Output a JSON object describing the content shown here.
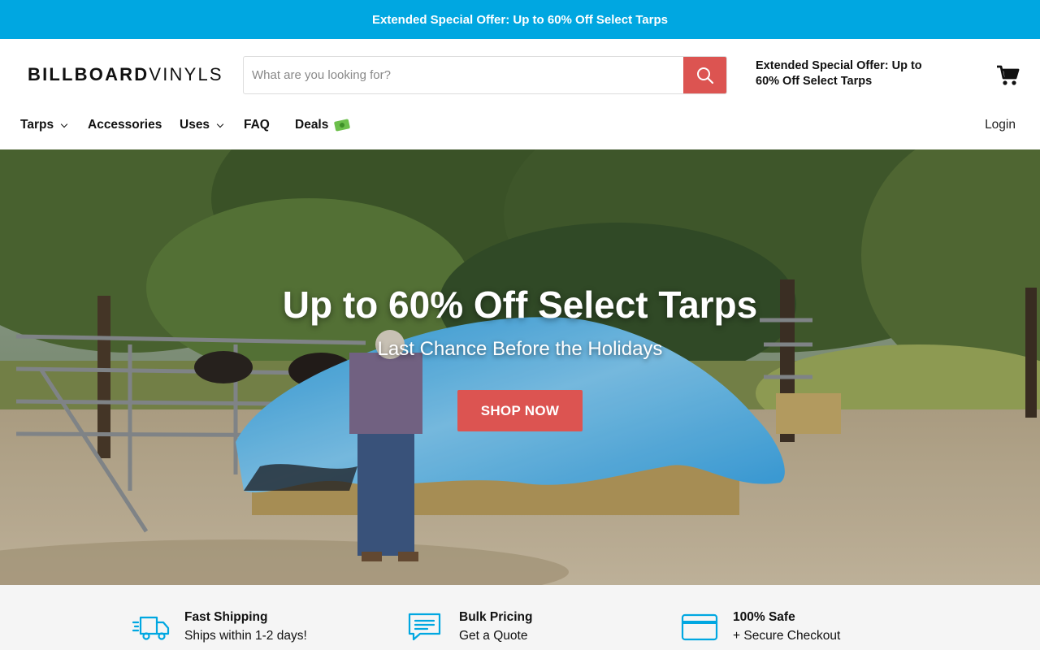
{
  "announcement": {
    "text": "Extended Special Offer: Up to 60% Off Select Tarps"
  },
  "header": {
    "logo_bold": "BILLBOARD",
    "logo_thin": "VINYLS",
    "search": {
      "placeholder": "What are you looking for?",
      "value": ""
    },
    "promo": "Extended Special Offer: Up to 60% Off Select Tarps",
    "cart_icon": "cart-icon"
  },
  "nav": {
    "items": [
      {
        "label": "Tarps",
        "dropdown": true
      },
      {
        "label": "Accessories",
        "dropdown": false
      },
      {
        "label": "Uses",
        "dropdown": true
      },
      {
        "label": "FAQ",
        "dropdown": false
      },
      {
        "label": "Deals",
        "dropdown": false,
        "emoji_icon": "money-icon"
      }
    ],
    "login": "Login"
  },
  "hero": {
    "title": "Up to 60% Off Select Tarps",
    "subtitle": "Last Chance Before the Holidays",
    "button": "SHOP NOW"
  },
  "features": [
    {
      "icon": "truck-icon",
      "title": "Fast Shipping",
      "subtitle": "Ships within 1-2 days!"
    },
    {
      "icon": "chat-icon",
      "title": "Bulk Pricing",
      "subtitle": "Get a Quote"
    },
    {
      "icon": "credit-card-icon",
      "title": "100% Safe",
      "subtitle": "+ Secure Checkout"
    }
  ],
  "colors": {
    "announce_bg": "#00a7e1",
    "accent_red": "#dc5451",
    "feature_icon": "#00a7e1",
    "features_bg": "#f5f5f5"
  }
}
